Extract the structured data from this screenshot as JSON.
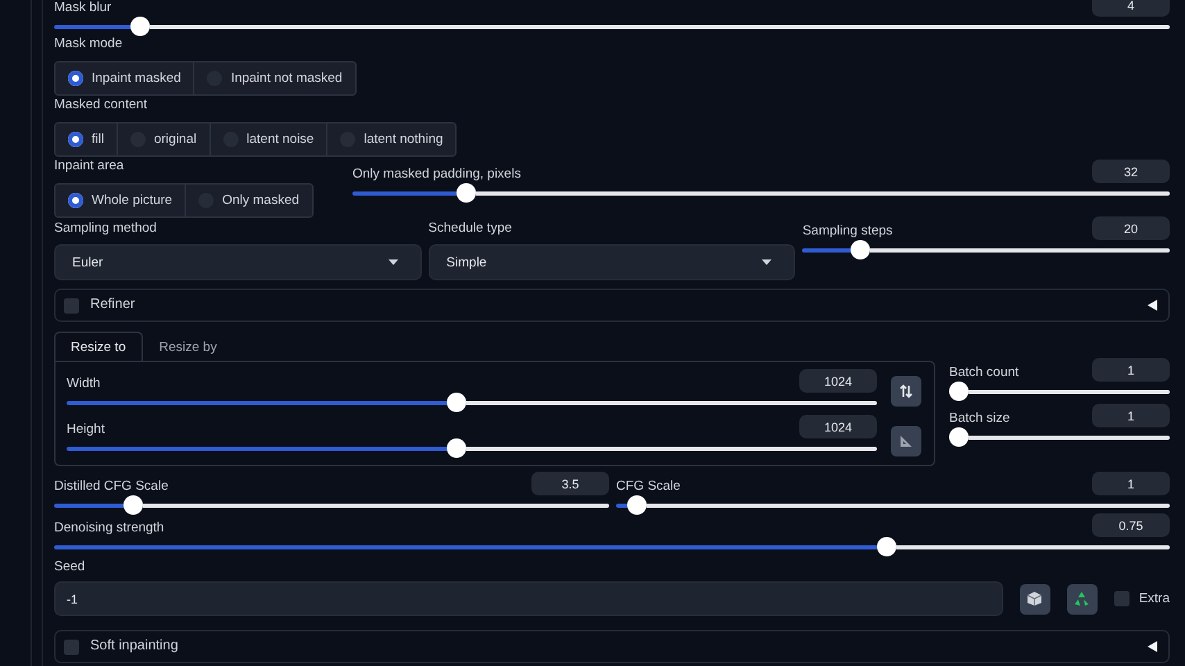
{
  "mask_blur": {
    "label": "Mask blur",
    "value": "4",
    "level": 0.07
  },
  "mask_mode": {
    "label": "Mask mode",
    "options": [
      {
        "label": "Inpaint masked",
        "selected": true
      },
      {
        "label": "Inpaint not masked",
        "selected": false
      }
    ]
  },
  "masked_content": {
    "label": "Masked content",
    "options": [
      {
        "label": "fill",
        "selected": true
      },
      {
        "label": "original",
        "selected": false
      },
      {
        "label": "latent noise",
        "selected": false
      },
      {
        "label": "latent nothing",
        "selected": false
      }
    ]
  },
  "inpaint_area": {
    "label": "Inpaint area",
    "options": [
      {
        "label": "Whole picture",
        "selected": true
      },
      {
        "label": "Only masked",
        "selected": false
      }
    ]
  },
  "only_masked_padding": {
    "label": "Only masked padding, pixels",
    "value": "32",
    "level": 0.13
  },
  "sampling_method": {
    "label": "Sampling method",
    "value": "Euler"
  },
  "schedule_type": {
    "label": "Schedule type",
    "value": "Simple"
  },
  "sampling_steps": {
    "label": "Sampling steps",
    "value": "20",
    "level": 0.14
  },
  "refiner": {
    "label": "Refiner",
    "checked": false,
    "expanded": false
  },
  "resize_tabs": [
    {
      "label": "Resize to",
      "selected": true
    },
    {
      "label": "Resize by",
      "selected": false
    }
  ],
  "width": {
    "label": "Width",
    "value": "1024",
    "level": 0.48
  },
  "height": {
    "label": "Height",
    "value": "1024",
    "level": 0.48
  },
  "batch_count": {
    "label": "Batch count",
    "value": "1",
    "level": 0
  },
  "batch_size": {
    "label": "Batch size",
    "value": "1",
    "level": 0
  },
  "distilled_cfg_scale": {
    "label": "Distilled CFG Scale",
    "value": "3.5",
    "level": 0.13
  },
  "cfg_scale": {
    "label": "CFG Scale",
    "value": "1",
    "level": 0.02
  },
  "denoising_strength": {
    "label": "Denoising strength",
    "value": "0.75",
    "level": 0.75
  },
  "seed": {
    "label": "Seed",
    "value": "-1"
  },
  "extra": {
    "label": "Extra",
    "checked": false
  },
  "soft_inpainting": {
    "label": "Soft inpainting",
    "checked": false,
    "expanded": false
  }
}
